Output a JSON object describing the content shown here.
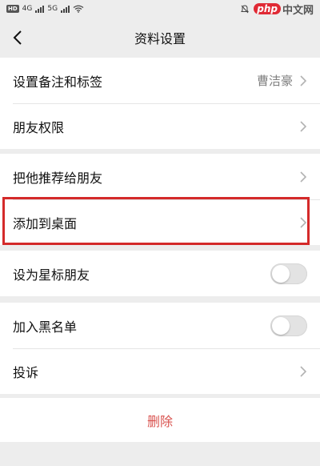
{
  "statusbar": {
    "hd": "HD",
    "net1": "4G",
    "net2": "5G",
    "watermark_php": "php",
    "watermark_site": "中文网"
  },
  "nav": {
    "title": "资料设置"
  },
  "groups": [
    {
      "items": [
        {
          "label": "设置备注和标签",
          "value": "曹洁豪",
          "control": "chevron"
        },
        {
          "label": "朋友权限",
          "control": "chevron"
        }
      ]
    },
    {
      "items": [
        {
          "label": "把他推荐给朋友",
          "control": "chevron"
        },
        {
          "label": "添加到桌面",
          "control": "chevron",
          "highlighted": true
        }
      ]
    },
    {
      "items": [
        {
          "label": "设为星标朋友",
          "control": "toggle",
          "on": false
        }
      ]
    },
    {
      "items": [
        {
          "label": "加入黑名单",
          "control": "toggle",
          "on": false
        },
        {
          "label": "投诉",
          "control": "chevron"
        }
      ]
    }
  ],
  "delete": {
    "label": "删除"
  },
  "colors": {
    "background": "#ededed",
    "delete_text": "#d9534f",
    "highlight_border": "#d42a2a",
    "toggle_off": "#e3e3e3"
  }
}
